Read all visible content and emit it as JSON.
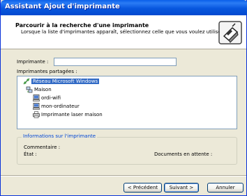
{
  "window": {
    "title": "Assistant Ajout d'imprimante"
  },
  "header": {
    "title": "Parcourir à la recherche d'une imprimante",
    "subtitle": "Lorsque la liste d'imprimantes apparaît, sélectionnez celle que vous voulez utiliser.",
    "icon": "printer-wizard-icon"
  },
  "printer_field": {
    "label": "Imprimante :",
    "value": ""
  },
  "shared": {
    "label": "Imprimantes partagées :",
    "items": [
      {
        "label": "Réseau Microsoft Windows",
        "icon": "network-icon",
        "selected": true
      },
      {
        "label": "Maison",
        "icon": "workgroup-icon",
        "selected": false
      },
      {
        "label": "ordi-wifi",
        "icon": "computer-icon",
        "selected": false
      },
      {
        "label": "mon-ordinateur",
        "icon": "computer-icon",
        "selected": false
      },
      {
        "label": "Imprimante laser maison",
        "icon": "printer-icon",
        "selected": false
      }
    ]
  },
  "info": {
    "legend": "Informations sur l'imprimante",
    "comment_label": "Commentaire :",
    "state_label": "État :",
    "pending_label": "Documents en attente :"
  },
  "buttons": {
    "back": "< Précédent",
    "next": "Suivant >",
    "cancel": "Annuler"
  },
  "colors": {
    "titlebar": "#0a5fe9",
    "selection": "#316ac5",
    "group_legend": "#0046d5"
  }
}
